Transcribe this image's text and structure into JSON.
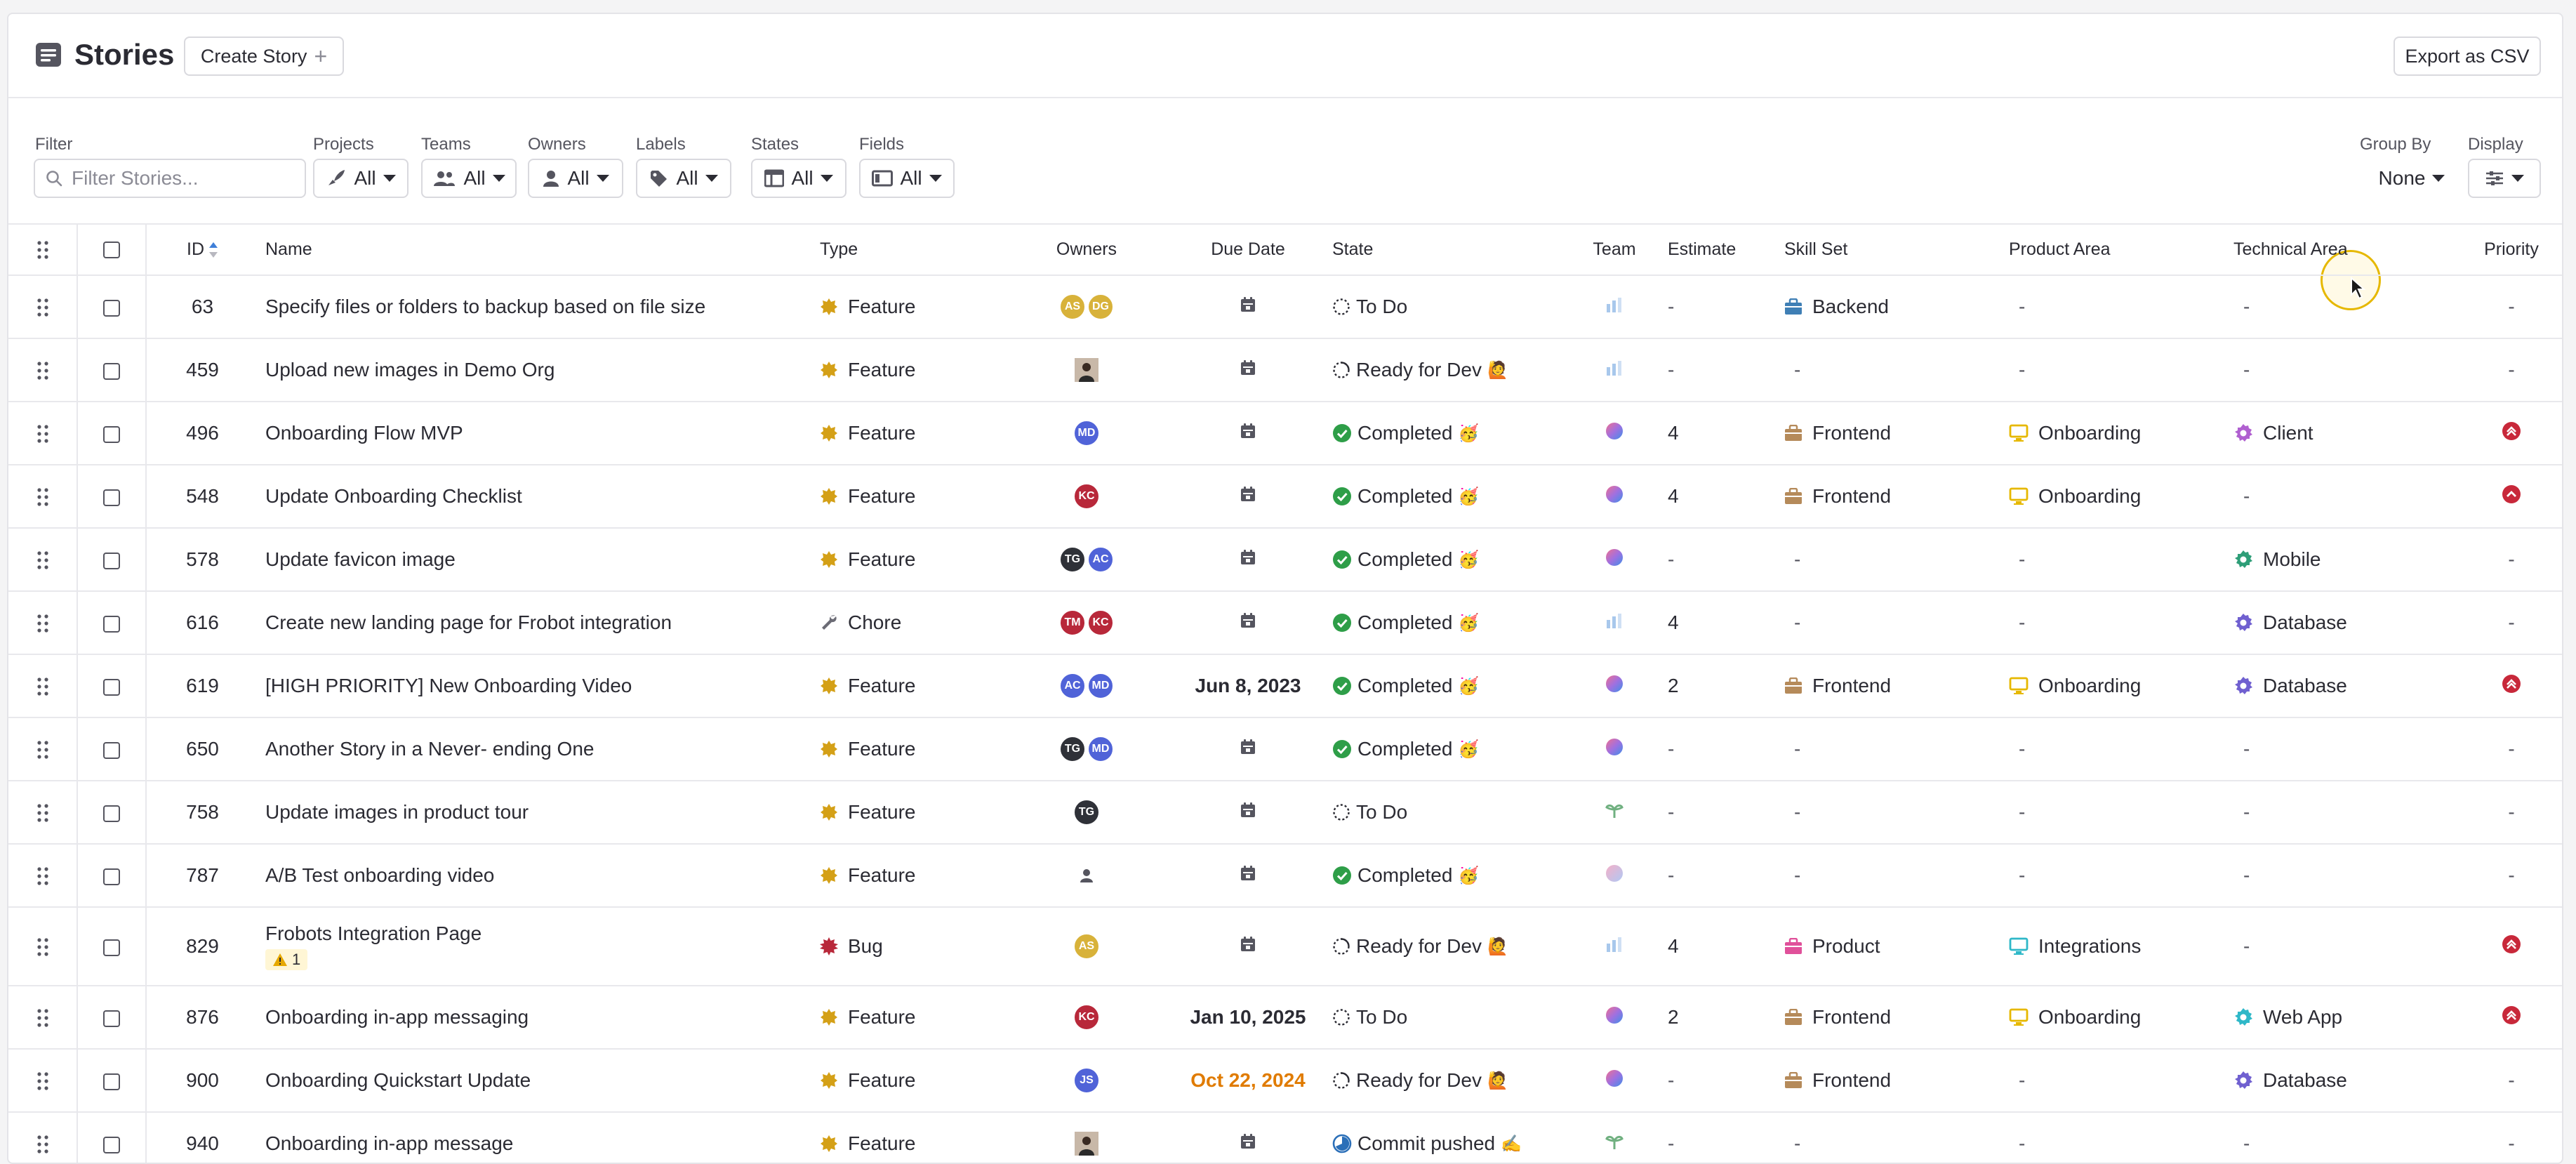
{
  "header": {
    "title": "Stories",
    "create_label": "Create Story",
    "export_label": "Export as CSV"
  },
  "filters": {
    "filter_label": "Filter",
    "search_placeholder": "Filter Stories...",
    "projects": {
      "label": "Projects",
      "value": "All"
    },
    "teams": {
      "label": "Teams",
      "value": "All"
    },
    "owners": {
      "label": "Owners",
      "value": "All"
    },
    "labels": {
      "label": "Labels",
      "value": "All"
    },
    "states": {
      "label": "States",
      "value": "All"
    },
    "fields": {
      "label": "Fields",
      "value": "All"
    },
    "group_by": {
      "label": "Group By",
      "value": "None"
    },
    "display": {
      "label": "Display"
    }
  },
  "columns": {
    "id": "ID",
    "name": "Name",
    "type": "Type",
    "owners": "Owners",
    "due": "Due Date",
    "state": "State",
    "team": "Team",
    "estimate": "Estimate",
    "skill": "Skill Set",
    "product": "Product Area",
    "tech": "Technical Area",
    "priority": "Priority"
  },
  "colors": {
    "feature": "#d4a017",
    "bug": "#b8283a",
    "chore": "#6b6b75",
    "completed": "#2e9e48",
    "priority_red": "#c8283a",
    "due_orange": "#e07b00",
    "backend": "#3f7fb5",
    "frontend": "#b58a5a",
    "product": "#e0509a",
    "onboarding": "#e6b800",
    "integrations": "#2fb8c8",
    "client": "#b060d0",
    "mobile": "#2e9e78",
    "database": "#7060d0",
    "webapp": "#2fb8c8"
  },
  "rows": [
    {
      "id": "63",
      "name": "Specify files or folders to backup based on file size",
      "type": "Feature",
      "owners": [
        "AS",
        "DG"
      ],
      "owner_colors": [
        "gold",
        "gold"
      ],
      "due": "",
      "state": "To Do",
      "state_icon": "todo",
      "state_emoji": "",
      "team": "team-chart-icon",
      "estimate": "-",
      "skill": "Backend",
      "skill_icon": "backend",
      "product": "-",
      "product_icon": "",
      "tech": "-",
      "tech_icon": "",
      "priority": "-"
    },
    {
      "id": "459",
      "name": "Upload new images in Demo Org",
      "type": "Feature",
      "owners": [
        "photo"
      ],
      "owner_colors": [
        "photo"
      ],
      "due": "",
      "state": "Ready for Dev",
      "state_icon": "ready",
      "state_emoji": "🙋",
      "team": "team-chart-icon",
      "estimate": "-",
      "skill": "-",
      "skill_icon": "",
      "product": "-",
      "product_icon": "",
      "tech": "-",
      "tech_icon": "",
      "priority": "-"
    },
    {
      "id": "496",
      "name": "Onboarding Flow MVP",
      "type": "Feature",
      "owners": [
        "MD"
      ],
      "owner_colors": [
        "blue"
      ],
      "due": "",
      "state": "Completed",
      "state_icon": "completed",
      "state_emoji": "🥳",
      "team": "team-orb-icon",
      "estimate": "4",
      "skill": "Frontend",
      "skill_icon": "frontend",
      "product": "Onboarding",
      "product_icon": "onboarding",
      "tech": "Client",
      "tech_icon": "client",
      "priority": "highest"
    },
    {
      "id": "548",
      "name": "Update Onboarding Checklist",
      "type": "Feature",
      "owners": [
        "KC"
      ],
      "owner_colors": [
        "red"
      ],
      "due": "",
      "state": "Completed",
      "state_icon": "completed",
      "state_emoji": "🥳",
      "team": "team-orb-icon",
      "estimate": "4",
      "skill": "Frontend",
      "skill_icon": "frontend",
      "product": "Onboarding",
      "product_icon": "onboarding",
      "tech": "-",
      "tech_icon": "",
      "priority": "high"
    },
    {
      "id": "578",
      "name": "Update favicon image",
      "type": "Feature",
      "owners": [
        "TG",
        "AC"
      ],
      "owner_colors": [
        "dark",
        "blue"
      ],
      "due": "",
      "state": "Completed",
      "state_icon": "completed",
      "state_emoji": "🥳",
      "team": "team-orb-icon",
      "estimate": "-",
      "skill": "-",
      "skill_icon": "",
      "product": "-",
      "product_icon": "",
      "tech": "Mobile",
      "tech_icon": "mobile",
      "priority": "-"
    },
    {
      "id": "616",
      "name": "Create new landing page for Frobot integration",
      "type": "Chore",
      "owners": [
        "TM",
        "KC"
      ],
      "owner_colors": [
        "red",
        "red"
      ],
      "due": "",
      "state": "Completed",
      "state_icon": "completed",
      "state_emoji": "🥳",
      "team": "team-chart-icon",
      "estimate": "4",
      "skill": "-",
      "skill_icon": "",
      "product": "-",
      "product_icon": "",
      "tech": "Database",
      "tech_icon": "database",
      "priority": "-"
    },
    {
      "id": "619",
      "name": "[HIGH PRIORITY] New Onboarding Video",
      "type": "Feature",
      "owners": [
        "AC",
        "MD"
      ],
      "owner_colors": [
        "blue",
        "blue"
      ],
      "due": "Jun 8, 2023",
      "due_style": "normal",
      "state": "Completed",
      "state_icon": "completed",
      "state_emoji": "🥳",
      "team": "team-orb-icon",
      "estimate": "2",
      "skill": "Frontend",
      "skill_icon": "frontend",
      "product": "Onboarding",
      "product_icon": "onboarding",
      "tech": "Database",
      "tech_icon": "database",
      "priority": "highest"
    },
    {
      "id": "650",
      "name": "Another Story in a Never- ending One",
      "type": "Feature",
      "owners": [
        "TG",
        "MD"
      ],
      "owner_colors": [
        "dark",
        "blue"
      ],
      "due": "",
      "state": "Completed",
      "state_icon": "completed",
      "state_emoji": "🥳",
      "team": "team-orb-icon",
      "estimate": "-",
      "skill": "-",
      "skill_icon": "",
      "product": "-",
      "product_icon": "",
      "tech": "-",
      "tech_icon": "",
      "priority": "-"
    },
    {
      "id": "758",
      "name": "Update images in product tour",
      "type": "Feature",
      "owners": [
        "TG"
      ],
      "owner_colors": [
        "dark"
      ],
      "due": "",
      "state": "To Do",
      "state_icon": "todo",
      "state_emoji": "",
      "team": "team-leaf-icon",
      "estimate": "-",
      "skill": "-",
      "skill_icon": "",
      "product": "-",
      "product_icon": "",
      "tech": "-",
      "tech_icon": "",
      "priority": "-"
    },
    {
      "id": "787",
      "name": "A/B Test onboarding video",
      "type": "Feature",
      "owners": [
        "ghost"
      ],
      "owner_colors": [
        "ghost"
      ],
      "due": "",
      "state": "Completed",
      "state_icon": "completed",
      "state_emoji": "🥳",
      "team": "team-orb-light-icon",
      "estimate": "-",
      "skill": "-",
      "skill_icon": "",
      "product": "-",
      "product_icon": "",
      "tech": "-",
      "tech_icon": "",
      "priority": "-"
    },
    {
      "id": "829",
      "name": "Frobots Integration Page",
      "warning": "1",
      "type": "Bug",
      "owners": [
        "AS"
      ],
      "owner_colors": [
        "gold"
      ],
      "due": "",
      "state": "Ready for Dev",
      "state_icon": "ready",
      "state_emoji": "🙋",
      "team": "team-chart-icon",
      "estimate": "4",
      "skill": "Product",
      "skill_icon": "product",
      "product": "Integrations",
      "product_icon": "integrations",
      "tech": "-",
      "tech_icon": "",
      "priority": "highest"
    },
    {
      "id": "876",
      "name": "Onboarding in-app messaging",
      "type": "Feature",
      "owners": [
        "KC"
      ],
      "owner_colors": [
        "red"
      ],
      "due": "Jan 10, 2025",
      "due_style": "normal",
      "state": "To Do",
      "state_icon": "todo",
      "state_emoji": "",
      "team": "team-orb-icon",
      "estimate": "2",
      "skill": "Frontend",
      "skill_icon": "frontend",
      "product": "Onboarding",
      "product_icon": "onboarding",
      "tech": "Web App",
      "tech_icon": "webapp",
      "priority": "highest"
    },
    {
      "id": "900",
      "name": "Onboarding Quickstart Update",
      "type": "Feature",
      "owners": [
        "JS"
      ],
      "owner_colors": [
        "blue"
      ],
      "due": "Oct 22, 2024",
      "due_style": "overdue",
      "state": "Ready for Dev",
      "state_icon": "ready",
      "state_emoji": "🙋",
      "team": "team-orb-icon",
      "estimate": "-",
      "skill": "Frontend",
      "skill_icon": "frontend",
      "product": "-",
      "product_icon": "",
      "tech": "Database",
      "tech_icon": "database",
      "priority": "-"
    },
    {
      "id": "940",
      "name": "Onboarding in-app message",
      "type": "Feature",
      "owners": [
        "photo2"
      ],
      "owner_colors": [
        "photo"
      ],
      "due": "",
      "state": "Commit pushed",
      "state_icon": "commit",
      "state_emoji": "✍️",
      "team": "team-leaf-icon",
      "estimate": "-",
      "skill": "-",
      "skill_icon": "",
      "product": "-",
      "product_icon": "",
      "tech": "-",
      "tech_icon": "",
      "priority": "-"
    }
  ]
}
